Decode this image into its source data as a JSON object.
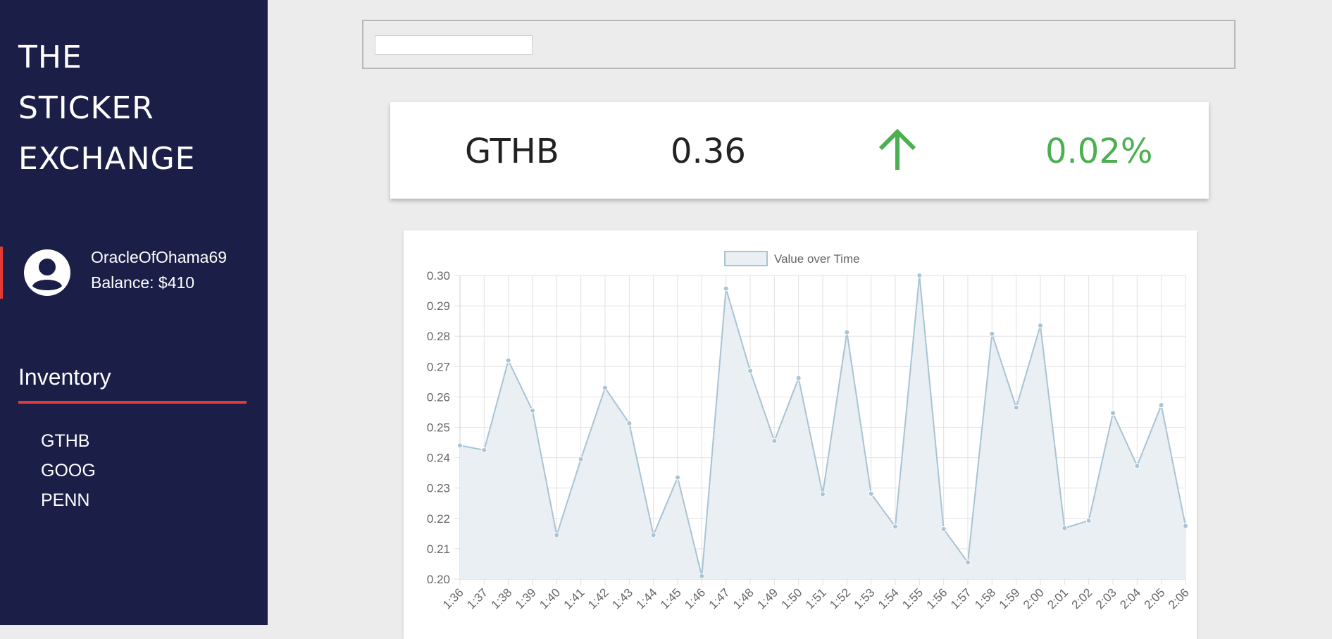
{
  "app": {
    "title_lines": [
      "THE",
      "STICKER",
      "EXCHANGE"
    ]
  },
  "user": {
    "name": "OracleOfOhama69",
    "balance": "Balance: $410",
    "icon": "account-circle-icon"
  },
  "inventory": {
    "title": "Inventory",
    "items": [
      "GTHB",
      "GOOG",
      "PENN"
    ]
  },
  "search": {
    "value": "",
    "placeholder": ""
  },
  "ticker": {
    "symbol": "GTHB",
    "price": "0.36",
    "direction_icon": "arrow-up-icon",
    "change": "0.02%",
    "change_color": "#4caf50"
  },
  "colors": {
    "sidebar": "#1b1f48",
    "accent": "#e53935",
    "up": "#4caf50",
    "series_line": "#a9c4d4",
    "series_fill": "#e9eff3"
  },
  "chart_data": {
    "type": "area",
    "title": "",
    "xlabel": "",
    "ylabel": "",
    "legend": [
      "Value over Time"
    ],
    "legend_position": "top-center",
    "grid": true,
    "ylim": [
      0.2,
      0.3
    ],
    "yticks": [
      "0.30",
      "0.29",
      "0.28",
      "0.27",
      "0.26",
      "0.25",
      "0.24",
      "0.23",
      "0.22",
      "0.21",
      "0.20"
    ],
    "x": [
      "1:36",
      "1:37",
      "1:38",
      "1:39",
      "1:40",
      "1:41",
      "1:42",
      "1:43",
      "1:44",
      "1:45",
      "1:46",
      "1:47",
      "1:48",
      "1:49",
      "1:50",
      "1:51",
      "1:52",
      "1:53",
      "1:54",
      "1:55",
      "1:56",
      "1:57",
      "1:58",
      "1:59",
      "2:00",
      "2:01",
      "2:02",
      "2:03",
      "2:04",
      "2:05",
      "2:06"
    ],
    "series": [
      {
        "name": "Value over Time",
        "values": [
          0.244,
          0.2425,
          0.272,
          0.2555,
          0.2145,
          0.2395,
          0.263,
          0.2513,
          0.2145,
          0.2335,
          0.201,
          0.2957,
          0.2686,
          0.2455,
          0.2662,
          0.228,
          0.2813,
          0.2281,
          0.2173,
          0.3,
          0.2165,
          0.2055,
          0.2808,
          0.2565,
          0.2835,
          0.2168,
          0.2193,
          0.2547,
          0.2373,
          0.2573,
          0.2175
        ]
      }
    ]
  }
}
